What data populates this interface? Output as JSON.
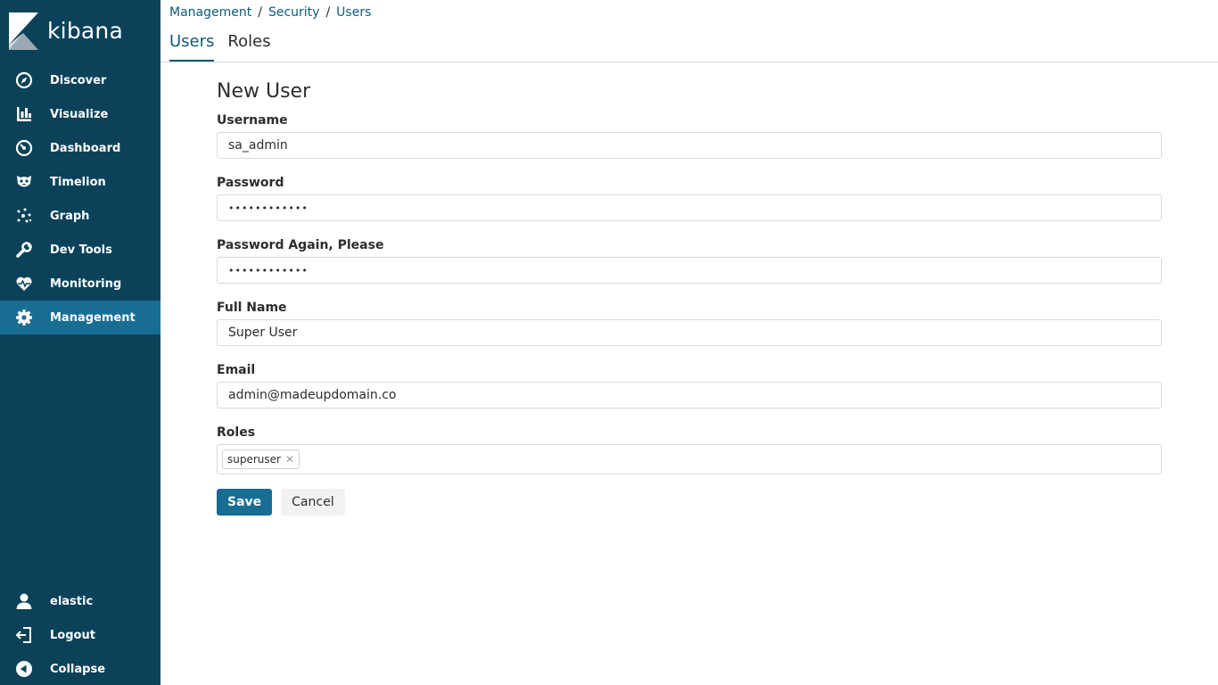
{
  "app": {
    "brand": "kibana",
    "accent": "#0b4259",
    "active_bg": "#186d92",
    "link_color": "#105a73"
  },
  "sidebar": {
    "items": [
      {
        "label": "Discover",
        "icon": "compass-icon"
      },
      {
        "label": "Visualize",
        "icon": "bar-chart-icon"
      },
      {
        "label": "Dashboard",
        "icon": "dashboard-gauge-icon"
      },
      {
        "label": "Timelion",
        "icon": "timelion-mask-icon"
      },
      {
        "label": "Graph",
        "icon": "graph-nodes-icon"
      },
      {
        "label": "Dev Tools",
        "icon": "wrench-icon"
      },
      {
        "label": "Monitoring",
        "icon": "heartbeat-icon"
      },
      {
        "label": "Management",
        "icon": "gear-icon",
        "active": true
      }
    ],
    "bottom": [
      {
        "label": "elastic",
        "icon": "user-icon"
      },
      {
        "label": "Logout",
        "icon": "logout-icon"
      },
      {
        "label": "Collapse",
        "icon": "collapse-icon"
      }
    ]
  },
  "breadcrumb": [
    "Management",
    "Security",
    "Users"
  ],
  "tabs": [
    {
      "label": "Users",
      "active": true
    },
    {
      "label": "Roles",
      "active": false
    }
  ],
  "form": {
    "title": "New User",
    "username": {
      "label": "Username",
      "value": "sa_admin"
    },
    "password": {
      "label": "Password",
      "value": "••••••••••••"
    },
    "password_again": {
      "label": "Password Again, Please",
      "value": "••••••••••••"
    },
    "full_name": {
      "label": "Full Name",
      "value": "Super User"
    },
    "email": {
      "label": "Email",
      "value": "admin@madeupdomain.co"
    },
    "roles": {
      "label": "Roles",
      "tags": [
        "superuser"
      ],
      "remove_glyph": "✕"
    },
    "save_label": "Save",
    "cancel_label": "Cancel"
  }
}
